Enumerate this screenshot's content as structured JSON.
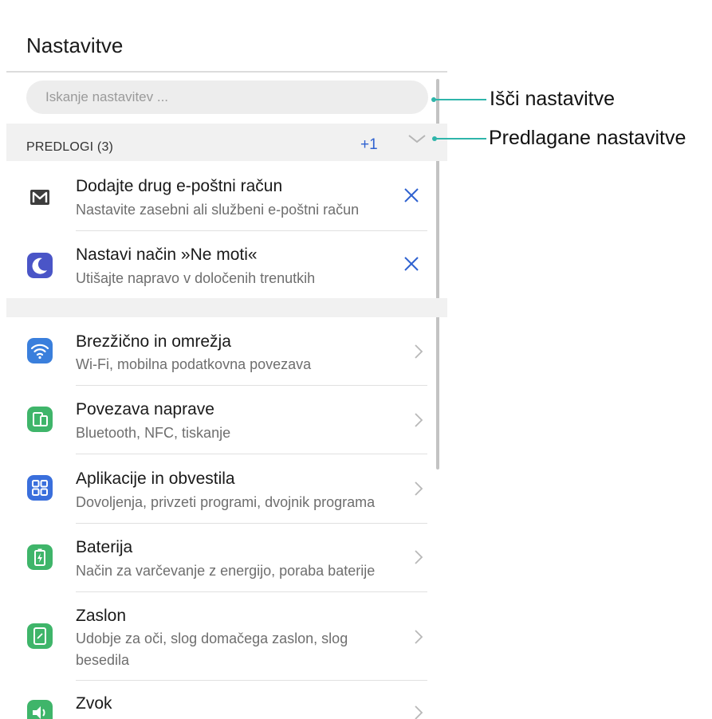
{
  "header": {
    "title": "Nastavitve"
  },
  "search": {
    "placeholder": "Iskanje nastavitev ..."
  },
  "suggestions": {
    "title": "PREDLOGI (3)",
    "more_count": "+1",
    "items": [
      {
        "title": "Dodajte drug e-poštni račun",
        "subtitle": "Nastavite zasebni ali službeni e-poštni račun",
        "icon": "mail-icon"
      },
      {
        "title": "Nastavi način »Ne moti«",
        "subtitle": "Utišajte napravo v določenih trenutkih",
        "icon": "moon-icon"
      }
    ]
  },
  "settings": {
    "items": [
      {
        "title": "Brezžično in omrežja",
        "subtitle": "Wi-Fi, mobilna podatkovna povezava",
        "icon": "wifi-icon"
      },
      {
        "title": "Povezava naprave",
        "subtitle": "Bluetooth, NFC, tiskanje",
        "icon": "device-connection-icon"
      },
      {
        "title": "Aplikacije in obvestila",
        "subtitle": "Dovoljenja, privzeti programi, dvojnik programa",
        "icon": "apps-icon"
      },
      {
        "title": "Baterija",
        "subtitle": "Način za varčevanje z energijo, poraba baterije",
        "icon": "battery-icon"
      },
      {
        "title": "Zaslon",
        "subtitle": "Udobje za oči, slog domačega zaslon, slog besedila",
        "icon": "display-icon"
      },
      {
        "title": "Zvok",
        "subtitle": "",
        "icon": "sound-icon"
      }
    ]
  },
  "callouts": {
    "search": "Išči nastavitve",
    "suggestions": "Predlagane nastavitve"
  },
  "colors": {
    "accent": "#2f62d0",
    "callout_line": "#2fb5aa",
    "mail_icon": "#3d3d3d",
    "moon_icon_bg": "#4a55c7",
    "wifi_icon_bg": "#3a7fdc",
    "green_icon_bg": "#3fb56a",
    "apps_icon_bg": "#3a6fdc"
  }
}
